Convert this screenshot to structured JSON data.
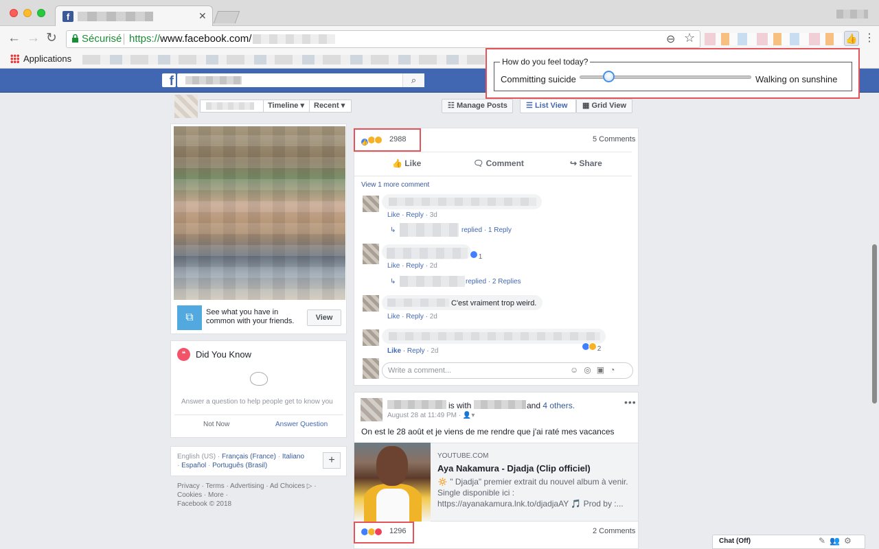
{
  "browser": {
    "secure_label": "Sécurisé",
    "url_prefix": "https://",
    "url_host": "www.facebook.com/",
    "bookmarks_apps_label": "Applications"
  },
  "extension_popup": {
    "question": "How do you feel today?",
    "left_label": "Committing suicide",
    "right_label": "Walking on sunshine",
    "slider_value_fraction": 0.17
  },
  "filter_bar": {
    "timeline_label": "Timeline",
    "recent_label": "Recent",
    "manage_posts_label": "Manage Posts",
    "list_view_label": "List View",
    "grid_view_label": "Grid View"
  },
  "common_card": {
    "text": "See what you have in common with your friends.",
    "view_label": "View"
  },
  "did_you_know": {
    "title": "Did You Know",
    "subtitle": "Answer a question to help people get to know you",
    "not_now": "Not Now",
    "answer": "Answer Question"
  },
  "languages": {
    "current": "English (US) · ",
    "l1": "Français (France)",
    "s1": " · ",
    "l2": "Italiano",
    "s2": " · ",
    "l3": "Español",
    "s3": " · ",
    "l4": "Português (Brasil)",
    "plus": "+"
  },
  "footer": {
    "line1": "Privacy · Terms · Advertising · Ad Choices ▷ ·",
    "line2": "Cookies · More ·",
    "copyright": "Facebook © 2018"
  },
  "post1": {
    "reaction_count": "2988",
    "comments_count": "5 Comments",
    "like_label": "Like",
    "comment_label": "Comment",
    "share_label": "Share",
    "view_more": "View 1 more comment",
    "comments": [
      {
        "meta_like": "Like",
        "meta_reply": "Reply",
        "time": "3d"
      },
      {
        "meta_like": "Like",
        "meta_reply": "Reply",
        "time": "2d",
        "reactions": "1"
      },
      {
        "meta_like": "Like",
        "meta_reply": "Reply",
        "time": "2d",
        "text": "C'est vraiment trop weird."
      },
      {
        "meta_like": "Like",
        "meta_reply": "Reply",
        "time": "2d",
        "reactions": "2"
      }
    ],
    "reply1_label": "replied · 1 Reply",
    "reply2_label": "replied · 2 Replies",
    "write_placeholder": "Write a comment..."
  },
  "post2": {
    "is_with": "is with",
    "and": "and ",
    "others": "4 others.",
    "date": "August 28 at 11:49 PM · ",
    "text": "On est le 28 août et je viens de me rendre que j'ai raté mes vacances",
    "link_domain": "YOUTUBE.COM",
    "link_title": "Aya Nakamura - Djadja (Clip officiel)",
    "link_desc": "🔅 \" Djadja\" premier extrait du nouvel album à venir. Single disponible ici : https://ayanakamura.lnk.to/djadjaAY 🎵 Prod by :...",
    "reaction_count": "1296",
    "comments_count": "2 Comments"
  },
  "chat": {
    "label": "Chat (Off)"
  },
  "colors": {
    "fb_blue": "#4267b2",
    "highlight_red": "#e2535a",
    "secure_green": "#1a8e34"
  },
  "icons": [
    "facebook-logo-icon",
    "close-icon",
    "back-icon",
    "forward-icon",
    "reload-icon",
    "lock-icon",
    "zoom-icon",
    "star-icon",
    "thumbs-up-extension-icon",
    "menu-icon",
    "apps-icon",
    "search-icon",
    "like-reaction-icon",
    "haha-reaction-icon",
    "wow-reaction-icon",
    "love-reaction-icon",
    "comment-icon",
    "share-icon",
    "camera-icon",
    "gif-icon",
    "sticker-icon",
    "emoji-icon",
    "speech-bubble-icon",
    "cloud-icon",
    "settings-icon"
  ]
}
